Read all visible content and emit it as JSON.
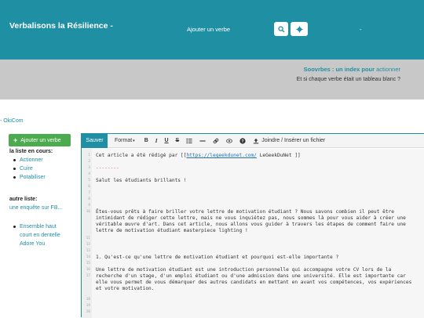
{
  "header": {
    "brand": "Verbalisons la Résilience -",
    "add_link": "Ajouter un verbe",
    "dash": "-"
  },
  "banner": {
    "title_bold": "Soovrbes : un index pour ",
    "title_lite": "actionner",
    "subtitle": "Et si chaque verbe était un tableau blanc ?"
  },
  "crumb": "- OkiCom",
  "sidebar": {
    "add_button": "Ajouter un verbe",
    "current_head": "la liste en cours:",
    "current_items": [
      "Actionner",
      "Cuire",
      "Potabiliser"
    ],
    "other_head": "autre liste:",
    "other_link": "une enquête sur FB...",
    "other_items": [
      "Ensemble haut court en dentelle Adore You"
    ]
  },
  "toolbar": {
    "save": "Sauver",
    "format": "Format",
    "bold": "B",
    "italic": "I",
    "underline": "U",
    "strike": "S",
    "attach": "Joindre / Insérer un fichier"
  },
  "editor": {
    "line1_pre": "Cet article a été rédigé par [[",
    "line1_link": "https://legeekdunet.com/",
    "line1_post": " LeGeekDuNet ]]",
    "line3": "--------",
    "line5": "Salut les étudiants brillants !",
    "line10": "Êtes-vous prêts à faire briller votre lettre de motivation étudiant ? Nous savons combien il peut être intimidant de rédiger cette lettre, mais ne vous inquiétez pas, nous sommes là pour vous aider à créer une véritable œuvre d'art. Dans cet article, nous allons vous guider à travers les étapes de comment faire une lettre de motivation étudiant masterpiece lighting !",
    "line15": "1. Qu'est-ce qu'une lettre de motivation étudiant et pourquoi est-elle importante ?",
    "line17": "Une lettre de motivation étudiant est une introduction personnelle qui accompagne votre CV lors de la recherche d'un stage, d'un emploi étudiant ou d'une admission dans une université. Elle est importante car elle vous permet de vous démarquer des autres candidats en mettant en avant vos compétences, vos expériences et votre motivation.",
    "line_numbers": [
      "1",
      "2",
      "3",
      "4",
      "5",
      "6",
      "7",
      "8",
      "9",
      "10",
      "11",
      "12",
      "13",
      "14",
      "15",
      "16",
      "17",
      "18",
      "19",
      "20"
    ]
  },
  "colors": {
    "primary": "#1f8fa4",
    "green": "#4caa4f",
    "banner": "#c8c8c8"
  }
}
